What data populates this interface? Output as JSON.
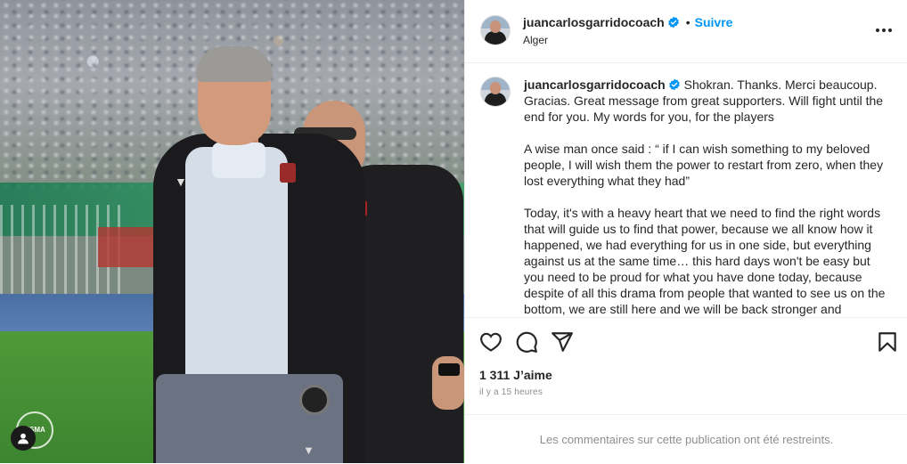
{
  "post": {
    "username": "juancarlosgarridocoach",
    "follow_label": "Suivre",
    "location": "Alger",
    "caption_username": "juancarlosgarridocoach",
    "caption_paragraphs": [
      "Shokran. Thanks. Merci beaucoup. Gracias. Great message from great supporters. Will fight until the end for you. My words for you, for the players",
      "A wise man once said : “ if I can wish something to my beloved people, I will wish them the power to restart from zero, when they lost everything what they had”",
      "Today, it's with a heavy heart that we need to find the right words that will guide us to find that power, because we all know how it happened, we had everything for us in one side, but everything against us at the same time… this hard days won't be easy but you need to be proud for what you have done today, because despite of all this drama from people that wanted to see us on the bottom, we are still here and we will be back stronger and"
    ],
    "likes": "1 311 J’aime",
    "timestamp": "il y a 15 heures",
    "comments_restricted": "Les commentaires sur cette publication ont été restreints."
  },
  "icons": {
    "verified": "verified-badge-icon",
    "more": "more-options-icon",
    "like": "heart-icon",
    "comment": "comment-icon",
    "share": "share-icon",
    "save": "bookmark-icon",
    "tagged_user": "user-tag-icon"
  },
  "colors": {
    "accent": "#0095f6",
    "text": "#262626",
    "muted": "#8e8e8e",
    "divider": "#efefef"
  }
}
